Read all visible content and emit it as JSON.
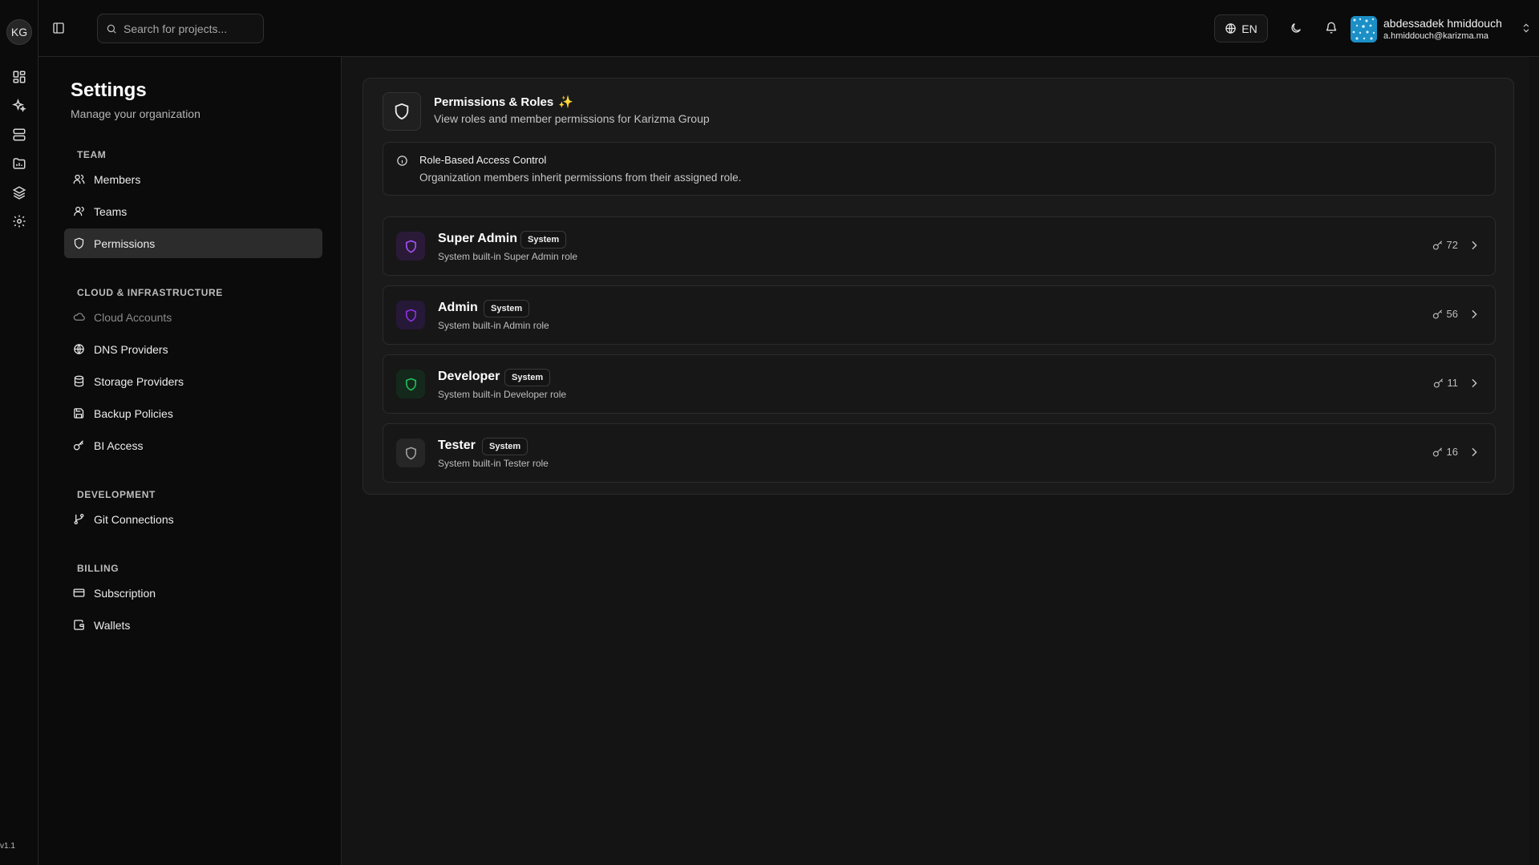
{
  "rail": {
    "org_initials": "KG",
    "items": [
      {
        "icon": "dashboard-grid-icon"
      },
      {
        "icon": "sparkles-icon"
      },
      {
        "icon": "servers-icon"
      },
      {
        "icon": "folder-chart-icon"
      },
      {
        "icon": "layers-icon"
      },
      {
        "icon": "gear-icon"
      }
    ],
    "version": "v1.1"
  },
  "topbar": {
    "search_placeholder": "Search for projects...",
    "language": "EN",
    "user": {
      "name": "abdessadek hmiddouch",
      "email": "a.hmiddouch@karizma.ma"
    }
  },
  "settings": {
    "title": "Settings",
    "subtitle": "Manage your organization",
    "groups": [
      {
        "label": "TEAM",
        "items": [
          {
            "label": "Members",
            "icon": "users-icon",
            "active": false,
            "disabled": false
          },
          {
            "label": "Teams",
            "icon": "user-icon",
            "active": false,
            "disabled": false
          },
          {
            "label": "Permissions",
            "icon": "shield-icon",
            "active": true,
            "disabled": false
          }
        ]
      },
      {
        "label": "CLOUD & INFRASTRUCTURE",
        "items": [
          {
            "label": "Cloud Accounts",
            "icon": "cloud-icon",
            "active": false,
            "disabled": true
          },
          {
            "label": "DNS Providers",
            "icon": "globe-icon",
            "active": false,
            "disabled": false
          },
          {
            "label": "Storage Providers",
            "icon": "database-icon",
            "active": false,
            "disabled": false
          },
          {
            "label": "Backup Policies",
            "icon": "save-icon",
            "active": false,
            "disabled": false
          },
          {
            "label": "BI Access",
            "icon": "key-icon",
            "active": false,
            "disabled": false
          }
        ]
      },
      {
        "label": "DEVELOPMENT",
        "items": [
          {
            "label": "Git Connections",
            "icon": "git-branch-icon",
            "active": false,
            "disabled": false
          }
        ]
      },
      {
        "label": "BILLING",
        "items": [
          {
            "label": "Subscription",
            "icon": "credit-card-icon",
            "active": false,
            "disabled": false
          },
          {
            "label": "Wallets",
            "icon": "wallet-icon",
            "active": false,
            "disabled": false
          }
        ]
      }
    ]
  },
  "main": {
    "title": "Permissions & Roles",
    "title_emoji": "✨",
    "subtitle": "View roles and member permissions for Karizma Group",
    "info": {
      "title": "Role-Based Access Control",
      "text": "Organization members inherit permissions from their assigned role."
    },
    "roles": [
      {
        "name": "Super Admin",
        "badge": "System",
        "description": "System built-in Super Admin role",
        "permissions": "72",
        "color": "#a855f7",
        "bg": "#2a1a38"
      },
      {
        "name": "Admin",
        "badge": "System",
        "description": "System built-in Admin role",
        "permissions": "56",
        "color": "#9333ea",
        "bg": "#261837"
      },
      {
        "name": "Developer",
        "badge": "System",
        "description": "System built-in Developer role",
        "permissions": "11",
        "color": "#22c55e",
        "bg": "#14291c"
      },
      {
        "name": "Tester",
        "badge": "System",
        "description": "System built-in Tester role",
        "permissions": "16",
        "color": "#a3a3a3",
        "bg": "#262626"
      }
    ]
  }
}
